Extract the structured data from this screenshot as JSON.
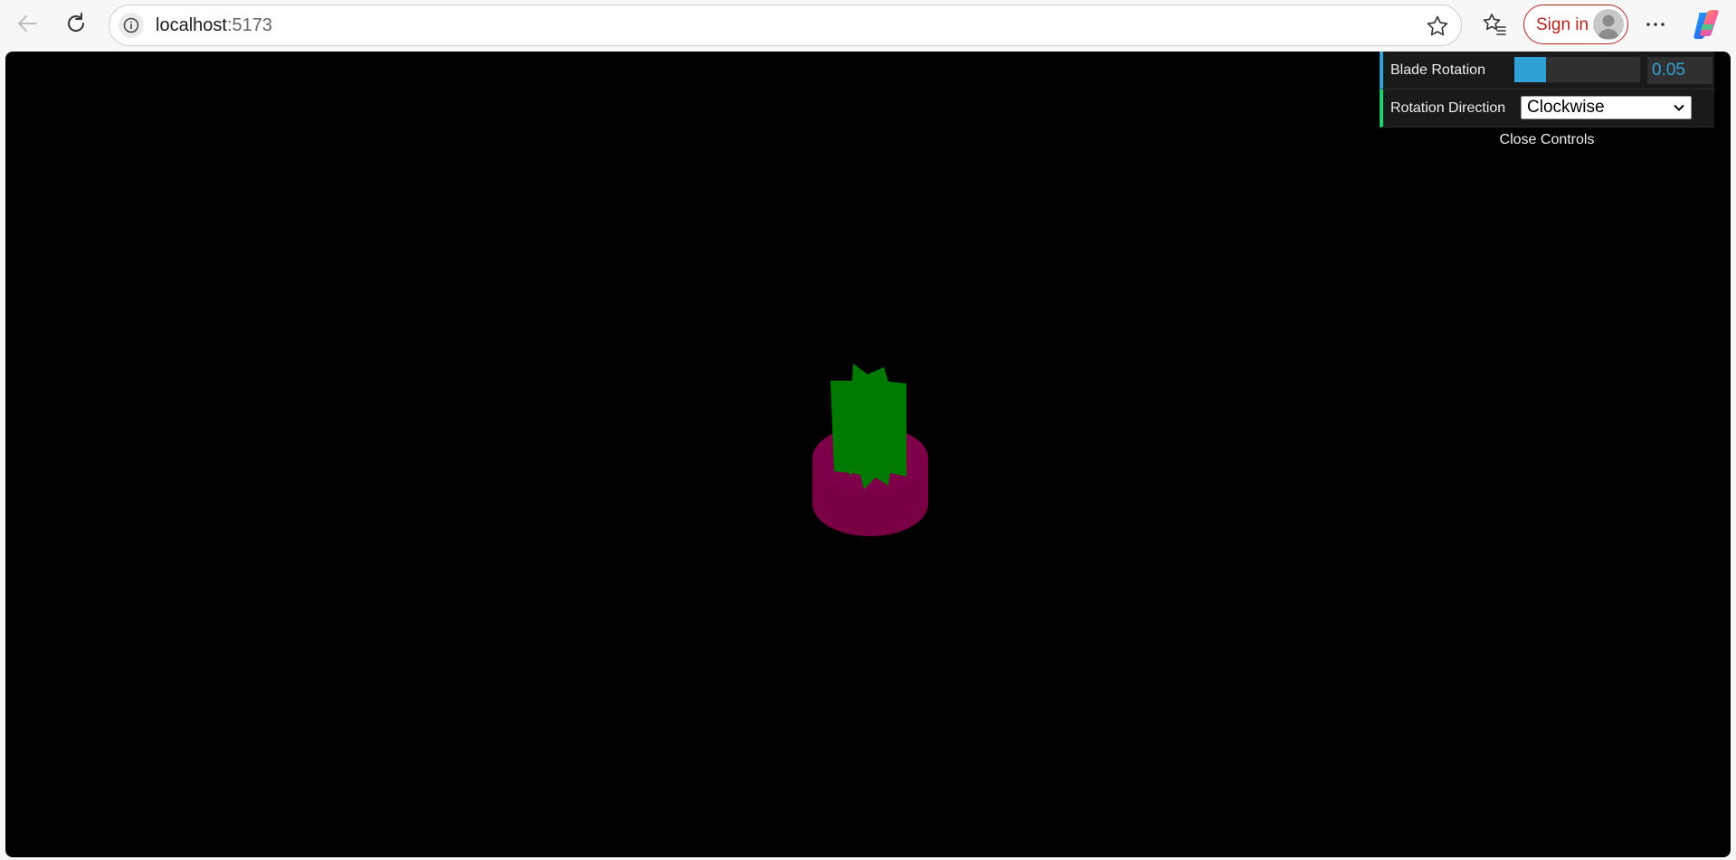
{
  "browser": {
    "url_host": "localhost",
    "url_port": ":5173",
    "signin_label": "Sign in"
  },
  "gui": {
    "blade_rotation_label": "Blade Rotation",
    "blade_rotation_value": "0.05",
    "blade_rotation_fraction": 0.25,
    "rotation_direction_label": "Rotation Direction",
    "rotation_direction_value": "Clockwise",
    "close_label": "Close Controls"
  },
  "scene": {
    "background": "#000000",
    "base_color": "#7a0044",
    "blade_color": "#007a00"
  },
  "icons": [
    "back-arrow-icon",
    "reload-icon",
    "info-icon",
    "star-icon",
    "favorites-icon",
    "avatar-icon",
    "more-icon",
    "copilot-icon",
    "chevron-down-icon"
  ]
}
